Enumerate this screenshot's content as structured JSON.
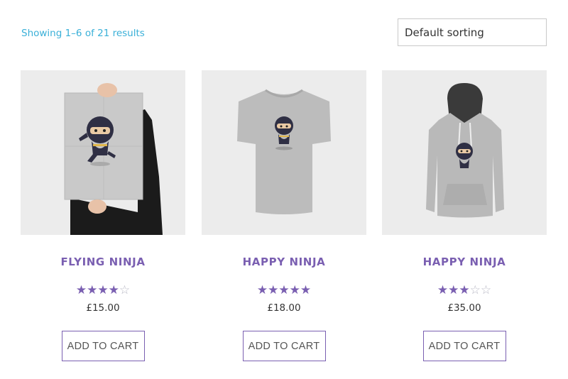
{
  "shop": {
    "result_count": "Showing 1–6 of 21 results",
    "sorting": "Default sorting"
  },
  "products": [
    {
      "title": "FLYING NINJA",
      "rating": 4,
      "rating_max": 5,
      "price": "£15.00",
      "cart_label": "ADD TO CART",
      "image": "poster-ninja-image"
    },
    {
      "title": "HAPPY NINJA",
      "rating": 5,
      "rating_max": 5,
      "price": "£18.00",
      "cart_label": "ADD TO CART",
      "image": "tshirt-ninja-image"
    },
    {
      "title": "HAPPY NINJA",
      "rating": 3,
      "rating_max": 5,
      "price": "£35.00",
      "cart_label": "ADD TO CART",
      "image": "hoodie-ninja-image"
    }
  ],
  "colors": {
    "accent": "#7a5fb1",
    "link": "#3ab0d8",
    "thumb_bg": "#ececec"
  }
}
